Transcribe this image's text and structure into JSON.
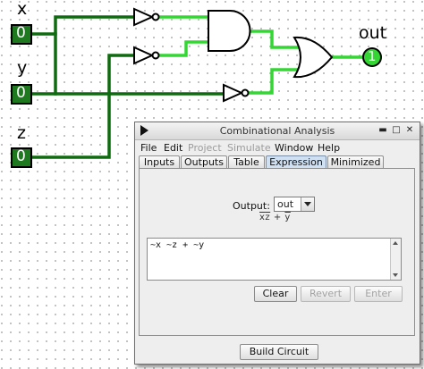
{
  "circuit": {
    "inputs": [
      {
        "label": "x",
        "value": "0"
      },
      {
        "label": "y",
        "value": "0"
      },
      {
        "label": "z",
        "value": "0"
      }
    ],
    "output": {
      "label": "out",
      "value": "1"
    },
    "colors": {
      "high": "#33d633",
      "low": "#0f6b0f",
      "pin_bg": "#1f7a1f"
    }
  },
  "dialog": {
    "title": "Combinational Analysis",
    "menu": [
      "File",
      "Edit",
      "Project",
      "Simulate",
      "Window",
      "Help"
    ],
    "disabled_menus": [
      "Project",
      "Simulate"
    ],
    "tabs": [
      "Inputs",
      "Outputs",
      "Table",
      "Expression",
      "Minimized"
    ],
    "active_tab": "Expression",
    "output_label": "Output:",
    "output_selected": "out",
    "expression_preview": {
      "term1": "x",
      "term2": "z",
      "plus": " + ",
      "term3": "y"
    },
    "expression_text": "~x ~z + ~y",
    "buttons": {
      "clear": "Clear",
      "revert": "Revert",
      "enter": "Enter"
    },
    "build_button": "Build Circuit"
  }
}
